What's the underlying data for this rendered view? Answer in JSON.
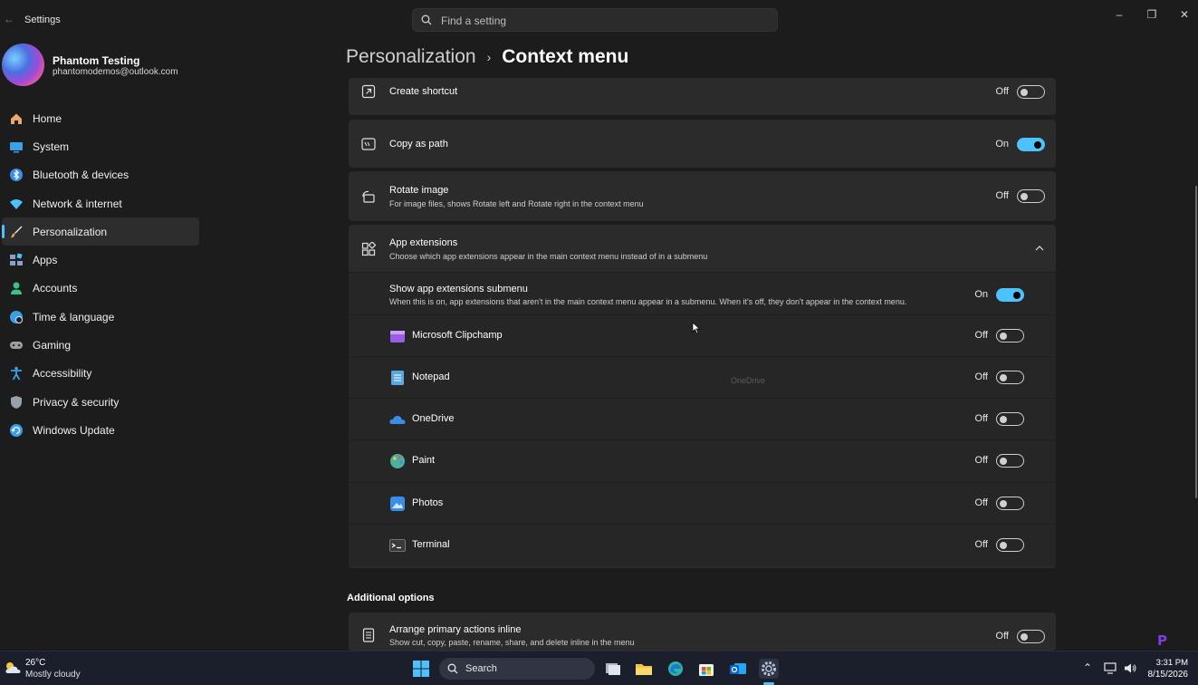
{
  "window": {
    "title": "Settings",
    "search_placeholder": "Find a setting",
    "controls": {
      "minimize": "–",
      "restore": "❐",
      "close": "✕"
    }
  },
  "profile": {
    "name": "Phantom Testing",
    "email": "phantomodemos@outlook.com"
  },
  "sidebar": {
    "items": [
      {
        "label": "Home",
        "icon": "home-icon",
        "color": "#e8a86a"
      },
      {
        "label": "System",
        "icon": "monitor-icon",
        "color": "#3aa0e8"
      },
      {
        "label": "Bluetooth & devices",
        "icon": "bluetooth-icon",
        "color": "#3a8ee8"
      },
      {
        "label": "Network & internet",
        "icon": "wifi-icon",
        "color": "#4cc2ff"
      },
      {
        "label": "Personalization",
        "icon": "brush-icon",
        "color": "#e8a060",
        "active": true
      },
      {
        "label": "Apps",
        "icon": "apps-icon",
        "color": "#8aa0c8"
      },
      {
        "label": "Accounts",
        "icon": "person-icon",
        "color": "#3ac08a"
      },
      {
        "label": "Time & language",
        "icon": "globe-clock-icon",
        "color": "#3a9ee8"
      },
      {
        "label": "Gaming",
        "icon": "gamepad-icon",
        "color": "#a0a0a0"
      },
      {
        "label": "Accessibility",
        "icon": "accessibility-icon",
        "color": "#3a9ee8"
      },
      {
        "label": "Privacy & security",
        "icon": "shield-icon",
        "color": "#9aa0a8"
      },
      {
        "label": "Windows Update",
        "icon": "update-icon",
        "color": "#3a9ee8"
      }
    ]
  },
  "breadcrumb": {
    "parent": "Personalization",
    "separator": "›",
    "current": "Context menu"
  },
  "settings": {
    "create_shortcut": {
      "title": "Create shortcut",
      "state": "Off"
    },
    "copy_as_path": {
      "title": "Copy as path",
      "state": "On"
    },
    "rotate_image": {
      "title": "Rotate image",
      "desc": "For image files, shows Rotate left and Rotate right in the context menu",
      "state": "Off"
    },
    "app_extensions": {
      "title": "App extensions",
      "desc": "Choose which app extensions appear in the main context menu instead of in a submenu"
    },
    "show_submenu": {
      "title": "Show app extensions submenu",
      "desc": "When this is on, app extensions that aren't in the main context menu appear in a submenu. When it's off, they don't appear in the context menu.",
      "state": "On"
    },
    "apps": [
      {
        "name": "Microsoft Clipchamp",
        "state": "Off",
        "icon": "clipchamp-icon",
        "color": "#9b5de5"
      },
      {
        "name": "Notepad",
        "state": "Off",
        "icon": "notepad-icon",
        "color": "#5aa8e0"
      },
      {
        "name": "OneDrive",
        "state": "Off",
        "icon": "onedrive-icon",
        "color": "#3a8ee8"
      },
      {
        "name": "Paint",
        "state": "Off",
        "icon": "paint-icon",
        "color": "#4cb0a0"
      },
      {
        "name": "Photos",
        "state": "Off",
        "icon": "photos-icon",
        "color": "#3a8ee8"
      },
      {
        "name": "Terminal",
        "state": "Off",
        "icon": "terminal-icon",
        "color": "#555555"
      }
    ],
    "ghost_text": "OneDrive"
  },
  "additional": {
    "heading": "Additional options",
    "arrange_inline": {
      "title": "Arrange primary actions inline",
      "desc": "Show cut, copy, paste, rename, share, and delete inline in the menu",
      "state": "Off"
    }
  },
  "taskbar": {
    "weather_temp": "26°C",
    "weather_desc": "Mostly cloudy",
    "search_label": "Search",
    "time": "3:31 PM",
    "date": "8/15/2026"
  },
  "colors": {
    "accent": "#4cc2ff",
    "card": "#2b2b2b",
    "bg": "#1c1c1c"
  }
}
